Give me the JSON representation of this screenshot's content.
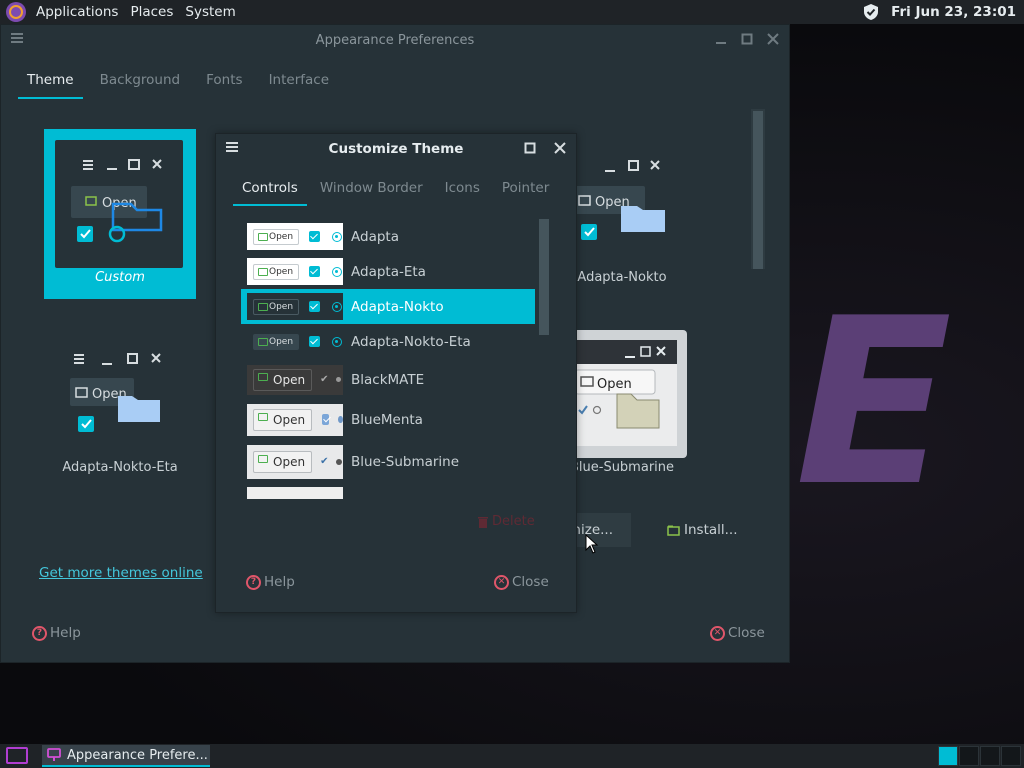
{
  "top_panel": {
    "menus": [
      "Applications",
      "Places",
      "System"
    ],
    "clock": "Fri Jun 23, 23:01"
  },
  "wallpaper_text": "E",
  "main_window": {
    "title": "Appearance Preferences",
    "tabs": [
      "Theme",
      "Background",
      "Fonts",
      "Interface"
    ],
    "themes": [
      {
        "name": "Custom"
      },
      {
        "name": "Adapta-Nokto"
      },
      {
        "name": "Adapta-Nokto-Eta"
      },
      {
        "name": "Blue-Submarine"
      }
    ],
    "preview_open_label": "Open",
    "customize_label_partial": "nize...",
    "install_label": "Install...",
    "get_more_link": "Get more themes online",
    "help_label": "Help",
    "close_label": "Close"
  },
  "dialog": {
    "title": "Customize Theme",
    "tabs": [
      "Controls",
      "Window Border",
      "Icons",
      "Pointer"
    ],
    "list": [
      {
        "name": "Adapta"
      },
      {
        "name": "Adapta-Eta"
      },
      {
        "name": "Adapta-Nokto"
      },
      {
        "name": "Adapta-Nokto-Eta"
      },
      {
        "name": "BlackMATE"
      },
      {
        "name": "BlueMenta"
      },
      {
        "name": "Blue-Submarine"
      }
    ],
    "thumb_open_label": "Open",
    "delete_label": "Delete",
    "help_label": "Help",
    "close_label": "Close"
  },
  "taskbar": {
    "task_label": "Appearance Prefere..."
  },
  "colors": {
    "accent": "#00bcd4",
    "window_bg": "#263238",
    "panel_bg": "#1f2327",
    "wallpaper_accent": "#5b3f76"
  }
}
